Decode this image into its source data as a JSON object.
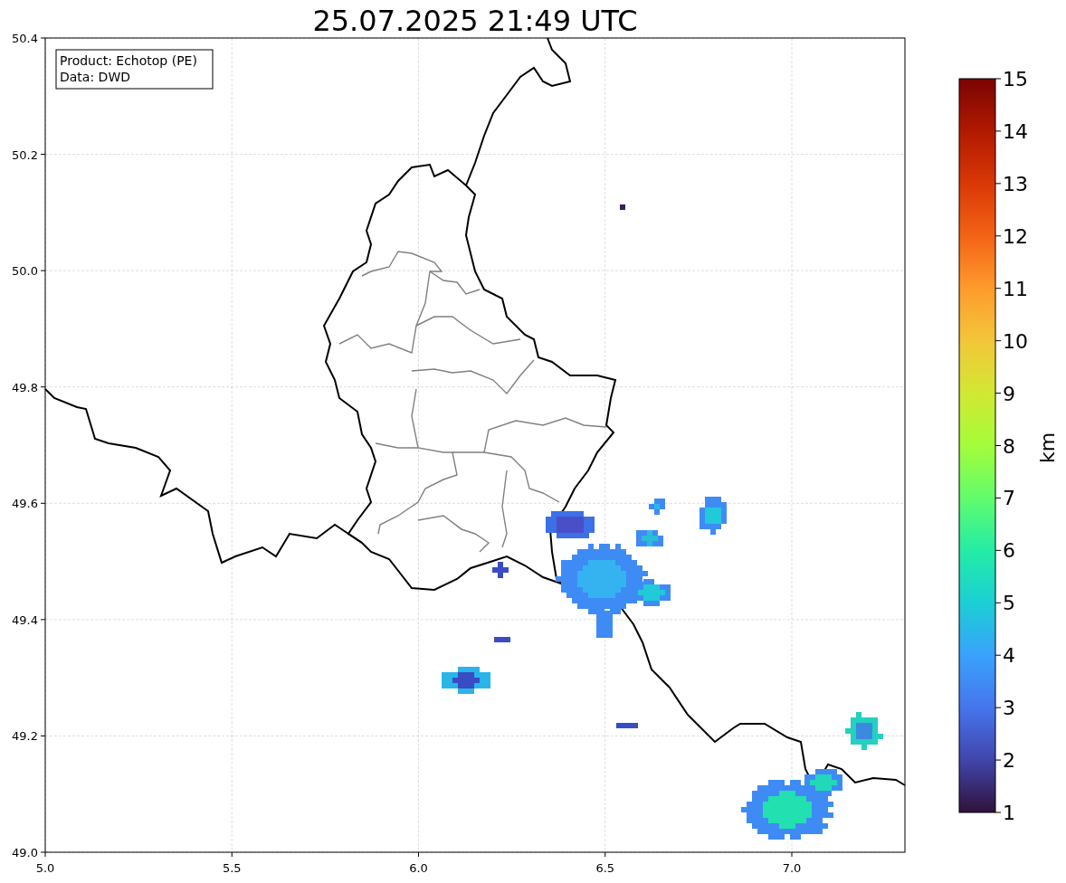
{
  "title": "25.07.2025 21:49 UTC",
  "info_box": {
    "lines": [
      "Product: Echotop (PE)",
      "Data: DWD"
    ]
  },
  "x_axis": {
    "ticks": [
      "5.0",
      "5.5",
      "6.0",
      "6.5",
      "7.0"
    ]
  },
  "y_axis": {
    "ticks": [
      "50.4",
      "50.2",
      "50.0",
      "49.8",
      "49.6",
      "49.4",
      "49.2",
      "49.0"
    ]
  },
  "colorbar": {
    "label": "km",
    "ticks": [
      "15",
      "14",
      "13",
      "12",
      "11",
      "10",
      "9",
      "8",
      "7",
      "6",
      "5",
      "4",
      "3",
      "2",
      "1"
    ]
  }
}
